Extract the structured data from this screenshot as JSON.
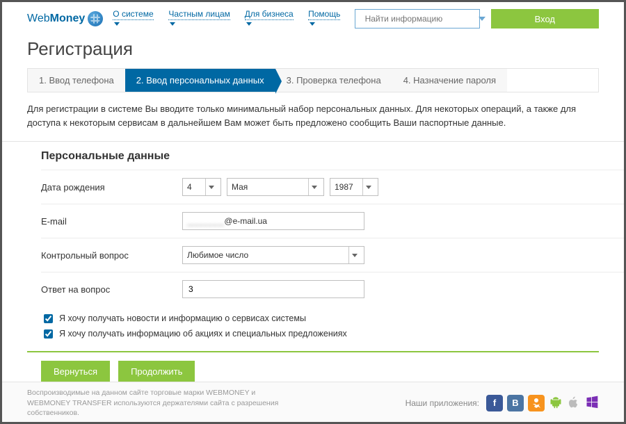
{
  "brand": {
    "web": "Web",
    "money": "Money"
  },
  "nav": {
    "about": "О системе",
    "personal": "Частным лицам",
    "business": "Для бизнеса",
    "help": "Помощь"
  },
  "search": {
    "placeholder": "Найти информацию"
  },
  "login": "Вход",
  "page_title": "Регистрация",
  "steps": {
    "s1": "1. Ввод телефона",
    "s2": "2. Ввод персональных данных",
    "s3": "3. Проверка телефона",
    "s4": "4. Назначение пароля"
  },
  "intro": "Для регистрации в системе Вы вводите только минимальный набор персональных данных. Для некоторых операций, а также для доступа к некоторым сервисам в дальнейшем Вам может быть предложено сообщить Ваши паспортные данные.",
  "form": {
    "section_title": "Персональные данные",
    "dob_label": "Дата рождения",
    "dob_day": "4",
    "dob_month": "Мая",
    "dob_year": "1987",
    "email_label": "E-mail",
    "email_masked": "________",
    "email_domain": "@e-mail.ua",
    "question_label": "Контрольный вопрос",
    "question_value": "Любимое число",
    "answer_label": "Ответ на вопрос",
    "answer_value": "3",
    "chk_news": "Я хочу получать новости и информацию о сервисах системы",
    "chk_promo": "Я хочу получать информацию об акциях и специальных предложениях"
  },
  "actions": {
    "back": "Вернуться",
    "next": "Продолжить"
  },
  "footer": {
    "copy": "Воспроизводимые на данном сайте торговые марки WEBMONEY и WEBMONEY TRANSFER используются держателями сайта с разрешения собственников.",
    "apps_label": "Наши приложения:"
  }
}
